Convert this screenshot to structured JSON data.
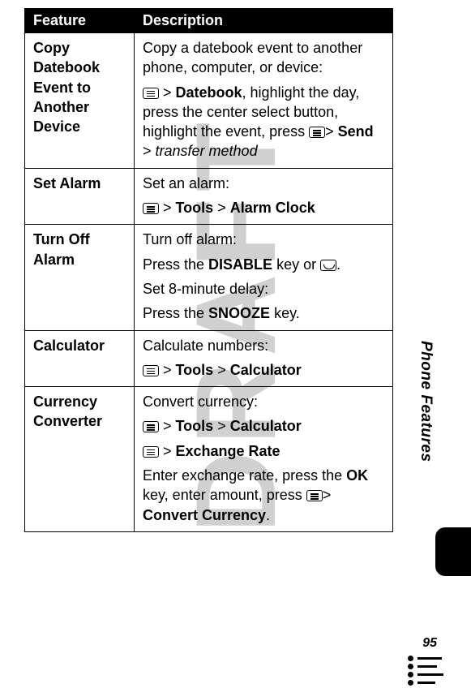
{
  "header": {
    "feature": "Feature",
    "description": "Description"
  },
  "rows": [
    {
      "feature": "Copy Datebook Event to Another Device",
      "desc1": "Copy a datebook event to another phone, computer, or device:",
      "step_a": " > ",
      "code_a": "Datebook",
      "step_b": ", highlight the day, press the center select button, highlight the event, press ",
      "step_c": "> ",
      "code_b": "Send",
      "step_d": " > ",
      "italic_a": "transfer method"
    },
    {
      "feature": "Set Alarm",
      "desc1": "Set an alarm:",
      "code_a": "Tools",
      "code_b": "Alarm Clock"
    },
    {
      "feature": "Turn Off Alarm",
      "desc1": "Turn off alarm:",
      "line2a": "Press the ",
      "code_a": "DISABLE",
      "line2b": " key or ",
      "line2c": ".",
      "line3": "Set 8-minute delay:",
      "line4a": "Press the ",
      "code_b": "SNOOZE",
      "line4b": " key."
    },
    {
      "feature": "Calculator",
      "desc1": "Calculate numbers:",
      "code_a": "Tools",
      "code_b": "Calculator"
    },
    {
      "feature": "Currency Converter",
      "desc1": "Convert currency:",
      "code_a": "Tools",
      "code_b": "Calculator",
      "code_c": "Exchange Rate",
      "line3a": "Enter exchange rate, press the ",
      "code_d": "OK",
      "line3b": " key, enter amount, press ",
      "line3c": "> ",
      "code_e": "Convert Currency",
      "line3d": "."
    }
  ],
  "side_label": "Phone Features",
  "page_number": "95"
}
